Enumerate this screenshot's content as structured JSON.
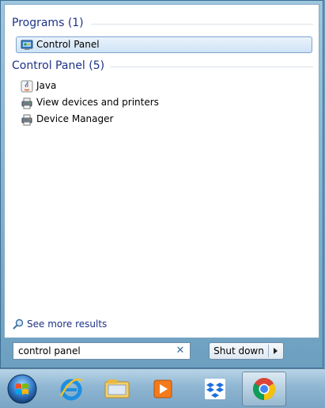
{
  "programs": {
    "header": "Programs (1)",
    "items": [
      {
        "label": "Control Panel",
        "icon": "control-panel-icon",
        "selected": true
      }
    ]
  },
  "control_panel": {
    "header": "Control Panel (5)",
    "items": [
      {
        "label": "Java",
        "icon": "java-icon"
      },
      {
        "label": "View devices and printers",
        "icon": "devices-printers-icon"
      },
      {
        "label": "Device Manager",
        "icon": "device-manager-icon"
      }
    ]
  },
  "see_more": "See more results",
  "search": {
    "value": "control panel",
    "clear_icon": "close-icon"
  },
  "shutdown": {
    "label": "Shut down"
  },
  "taskbar": {
    "items": [
      "start-orb-icon",
      "internet-explorer-icon",
      "file-explorer-icon",
      "media-player-icon",
      "dropbox-icon",
      "chrome-icon"
    ],
    "active": "chrome-icon"
  },
  "colors": {
    "header": "#1e3287",
    "accent": "#7da2ce",
    "frame": "#7fb0cf"
  }
}
